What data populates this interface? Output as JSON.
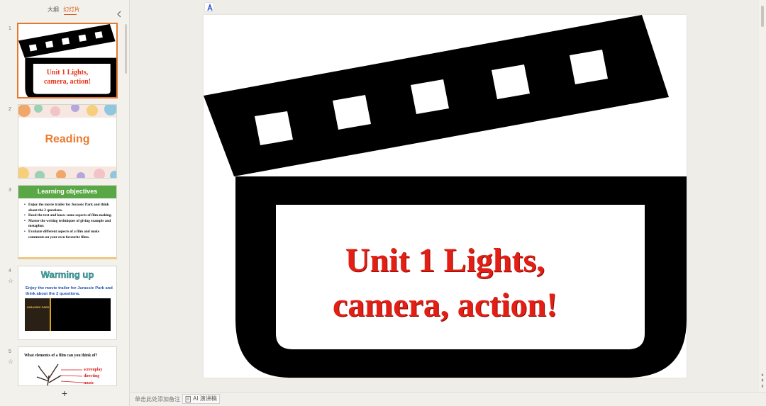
{
  "panel": {
    "tabs": [
      {
        "label": "大纲"
      },
      {
        "label": "幻灯片"
      }
    ],
    "active_tab": "幻灯片"
  },
  "thumbnails": [
    {
      "number": "1",
      "title_line1": "Unit 1 Lights,",
      "title_line2": "camera, action!",
      "active": true
    },
    {
      "number": "2",
      "title": "Reading"
    },
    {
      "number": "3",
      "header": "Learning objectives",
      "bullets": [
        "Enjoy the movie trailer for Jurassic Park and think about the 2 questions.",
        "Read the text and know some aspects of film-making.",
        "Master the writing techniques of giving example and metaphor.",
        "Evaluate different aspects of a film and make comments on your own favourite films."
      ]
    },
    {
      "number": "4",
      "title": "Warming up",
      "text": "Enjoy the movie trailer for Jurassic Park and think about the 2 questions.",
      "poster_text": "JURASSIC PARK"
    },
    {
      "number": "5",
      "question": "What elements of a film can you think of?",
      "labels": [
        "screenplay",
        "directing",
        "music"
      ]
    }
  ],
  "slide": {
    "title_line1": "Unit 1 Lights,",
    "title_line2": "camera, action!"
  },
  "status_bar": {
    "notes_placeholder": "单击此处添加备注",
    "ai_script_label": "AI 演讲稿"
  },
  "colors": {
    "accent": "#e6782d",
    "title_red": "#e31e14"
  }
}
